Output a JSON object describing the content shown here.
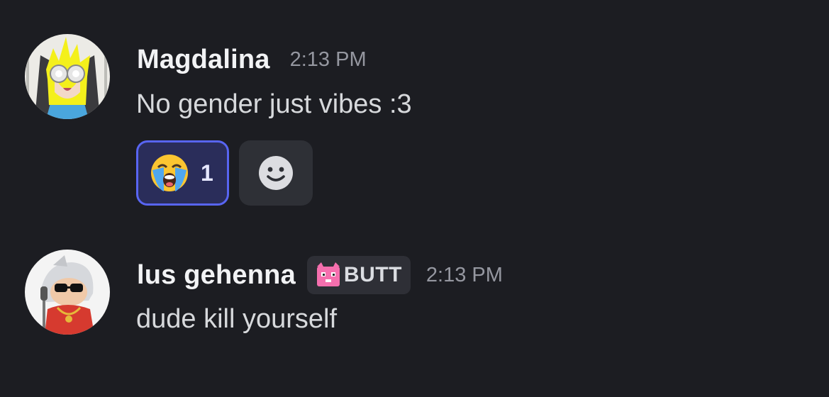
{
  "messages": [
    {
      "author": "Magdalina",
      "timestamp": "2:13 PM",
      "content": "No gender just vibes :3",
      "avatar_icon": "anime-girl-avatar",
      "reactions": [
        {
          "emoji": "loudly-crying-face",
          "count": "1",
          "selected": true
        }
      ],
      "add_reaction_icon": "smiley-face-icon"
    },
    {
      "author": "lus gehenna",
      "role_tag": "BUTT",
      "role_tag_icon": "pink-cat-icon",
      "timestamp": "2:13 PM",
      "content": "dude kill yourself",
      "avatar_icon": "hooded-rapper-avatar"
    }
  ],
  "colors": {
    "background": "#1c1d22",
    "accent": "#5865f2",
    "reaction_bg": "#2a2d5a"
  }
}
